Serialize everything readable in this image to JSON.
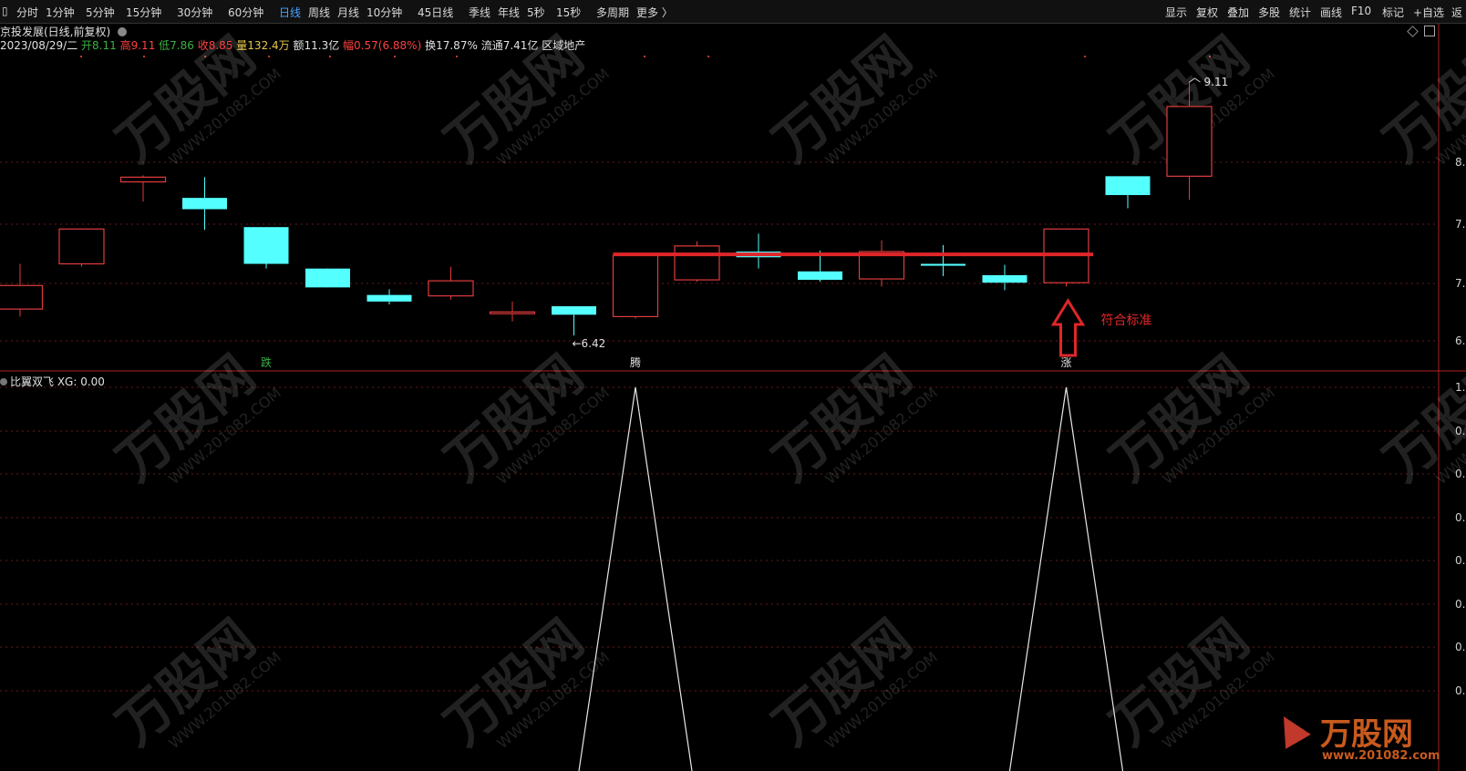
{
  "toolbar": {
    "left": [
      "分时",
      "1分钟",
      "5分钟",
      "15分钟",
      "30分钟",
      "60分钟",
      "日线",
      "周线",
      "月线",
      "10分钟",
      "45日线",
      "季线",
      "年线",
      "5秒",
      "15秒",
      "多周期",
      "更多 〉"
    ],
    "active": "日线",
    "right": [
      "显示",
      "复权",
      "叠加",
      "多股",
      "统计",
      "画线",
      "F10",
      "标记",
      "+自选",
      "返"
    ]
  },
  "info_bar": {
    "title": "京投发展(日线,前复权)",
    "date": "2023/08/29/二",
    "open": "开8.11",
    "high": "高9.11",
    "low": "低7.86",
    "close": "收8.85",
    "volume": "量132.4万",
    "amount": "额11.3亿",
    "change": "幅0.57(6.88%)",
    "turnover": "换17.87%",
    "float": "流通7.41亿",
    "sector": "区域地产"
  },
  "price_labels": {
    "low_marker": "←6.42",
    "high_marker": "9.11"
  },
  "axis_labels": {
    "main": [
      "8.",
      "7.",
      "7.",
      "6."
    ],
    "indicator": [
      "1.",
      "0.",
      "0.",
      "0.",
      "0.",
      "0.",
      "0.",
      "0."
    ]
  },
  "signals": [
    "跌",
    "腾",
    "涨"
  ],
  "annotation": "符合标准",
  "indicator_header": "比翼双飞 XG: 0.00",
  "watermark": {
    "text": "万股网",
    "url": "WWW.201082.COM",
    "corner_url": "www.201082.com"
  },
  "chart_data": {
    "type": "candlestick",
    "candles": [
      {
        "o": 6.95,
        "h": 7.18,
        "l": 6.62,
        "c": 6.7,
        "color": "red"
      },
      {
        "o": 7.18,
        "h": 7.55,
        "l": 7.15,
        "c": 7.55,
        "color": "red"
      },
      {
        "o": 8.1,
        "h": 8.12,
        "l": 7.84,
        "c": 8.05,
        "color": "red"
      },
      {
        "o": 7.88,
        "h": 8.1,
        "l": 7.54,
        "c": 7.76,
        "color": "cyan"
      },
      {
        "o": 7.57,
        "h": 7.57,
        "l": 7.13,
        "c": 7.18,
        "color": "cyan"
      },
      {
        "o": 7.13,
        "h": 7.1,
        "l": 6.96,
        "c": 6.93,
        "color": "cyan"
      },
      {
        "o": 6.85,
        "h": 6.91,
        "l": 6.75,
        "c": 6.78,
        "color": "cyan"
      },
      {
        "o": 6.84,
        "h": 7.15,
        "l": 6.8,
        "c": 7.0,
        "color": "red"
      },
      {
        "o": 6.67,
        "h": 6.78,
        "l": 6.57,
        "c": 6.67,
        "color": "red"
      },
      {
        "o": 6.73,
        "h": 6.73,
        "l": 6.42,
        "c": 6.64,
        "color": "cyan"
      },
      {
        "o": 6.62,
        "h": 7.27,
        "l": 6.6,
        "c": 7.27,
        "color": "red"
      },
      {
        "o": 7.01,
        "h": 7.42,
        "l": 6.99,
        "c": 7.37,
        "color": "red"
      },
      {
        "o": 7.31,
        "h": 7.5,
        "l": 7.13,
        "c": 7.25,
        "color": "cyan"
      },
      {
        "o": 7.1,
        "h": 7.32,
        "l": 6.99,
        "c": 7.01,
        "color": "cyan"
      },
      {
        "o": 7.02,
        "h": 7.43,
        "l": 6.94,
        "c": 7.31,
        "color": "red"
      },
      {
        "o": 7.18,
        "h": 7.38,
        "l": 7.05,
        "c": 7.16,
        "color": "cyan"
      },
      {
        "o": 7.06,
        "h": 7.17,
        "l": 6.9,
        "c": 6.98,
        "color": "cyan"
      },
      {
        "o": 6.98,
        "h": 7.55,
        "l": 6.94,
        "c": 7.55,
        "color": "red"
      },
      {
        "o": 8.11,
        "h": 8.11,
        "l": 7.77,
        "c": 7.91,
        "color": "cyan"
      },
      {
        "o": 8.11,
        "h": 9.11,
        "l": 7.86,
        "c": 8.85,
        "color": "red"
      }
    ],
    "support_line": {
      "from_index": 10,
      "to_index": 17,
      "value": 7.28
    },
    "indicator_signal_indices": [
      10,
      17
    ],
    "ylim": [
      6.15,
      9.4
    ]
  }
}
